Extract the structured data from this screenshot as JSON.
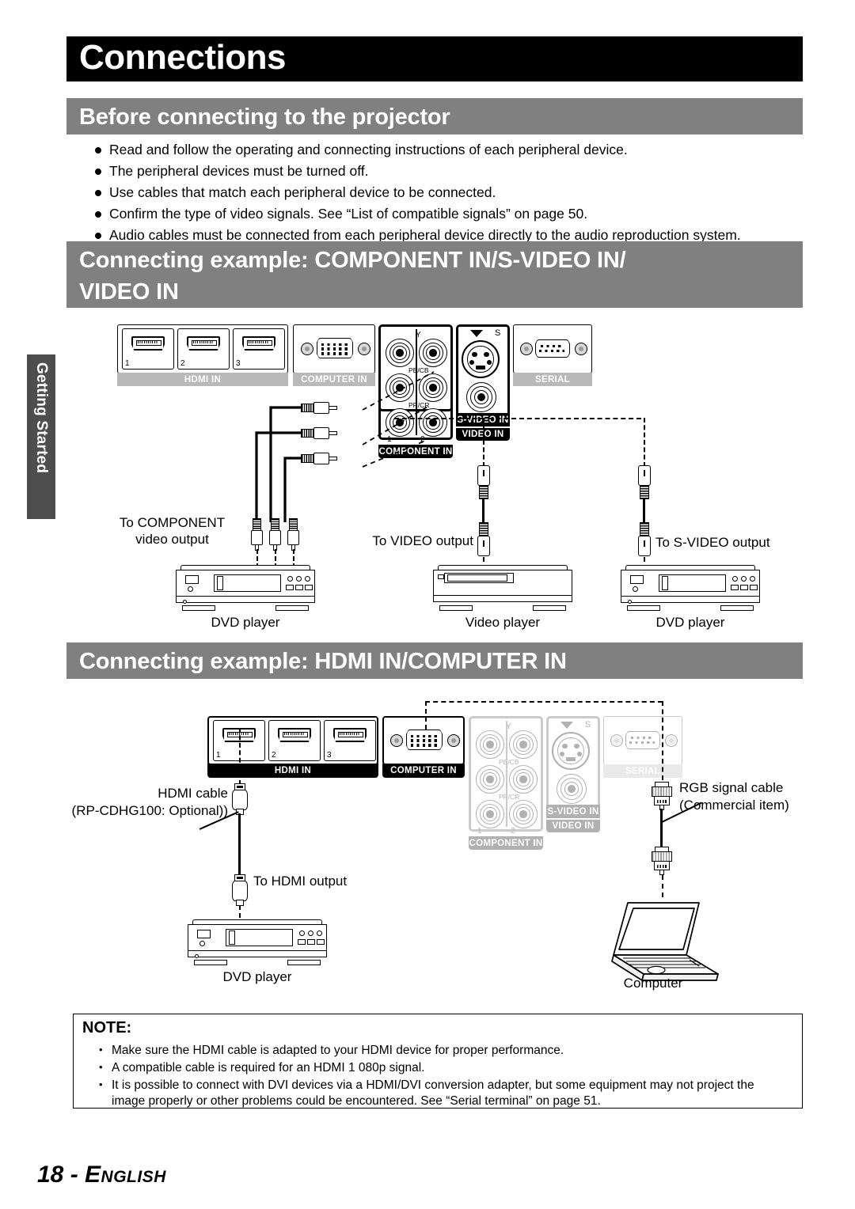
{
  "chapter": {
    "title": "Connections"
  },
  "side_tab": {
    "label": "Getting Started"
  },
  "sections": {
    "before": {
      "heading": "Before connecting to the projector",
      "bullets": [
        "Read and follow the operating and connecting instructions of each peripheral device.",
        "The peripheral devices must be turned off.",
        "Use cables that match each peripheral device to be connected.",
        "Confirm the type of video signals. See “List of compatible signals” on page 50.",
        "Audio cables must be connected from each peripheral device directly to the audio reproduction system."
      ]
    },
    "component_example": {
      "heading": "Connecting example: COMPONENT IN/S-VIDEO IN/\nVIDEO IN",
      "panel": {
        "hdmi_caption": "HDMI IN",
        "hdmi_numbers": [
          "1",
          "2",
          "3"
        ],
        "computer_caption": "COMPUTER IN",
        "component_caption": "COMPONENT IN",
        "component_numbers": [
          "1",
          "2"
        ],
        "component_rows": [
          "Y",
          "PB/CB",
          "PR/CR"
        ],
        "svideo_caption": "S-VIDEO IN",
        "video_caption": "VIDEO IN",
        "svideo_mark": "S",
        "serial_caption": "SERIAL"
      },
      "labels": {
        "component_out": "To COMPONENT\nvideo output",
        "video_out": "To VIDEO output",
        "svideo_out": "To S-VIDEO output"
      },
      "devices": [
        {
          "name": "DVD player"
        },
        {
          "name": "Video player"
        },
        {
          "name": "DVD player"
        }
      ]
    },
    "hdmi_example": {
      "heading": "Connecting example: HDMI IN/COMPUTER IN",
      "panel": {
        "hdmi_caption": "HDMI IN",
        "hdmi_numbers": [
          "1",
          "2",
          "3"
        ],
        "computer_caption": "COMPUTER IN",
        "component_caption": "COMPONENT IN",
        "component_numbers": [
          "1",
          "2"
        ],
        "component_rows": [
          "Y",
          "PB/CB",
          "PR/CR"
        ],
        "svideo_caption": "S-VIDEO IN",
        "video_caption": "VIDEO IN",
        "svideo_mark": "S",
        "serial_caption": "SERIAL"
      },
      "labels": {
        "hdmi_cable": "HDMI cable",
        "hdmi_cable_model": "(RP-CDHG100: Optional))",
        "hdmi_out": "To HDMI output",
        "rgb_cable": "RGB signal cable",
        "rgb_cable_note": "(Commercial item)",
        "dvd_player": "DVD player",
        "computer": "Computer"
      }
    }
  },
  "note": {
    "title": "NOTE:",
    "items": [
      "Make sure the HDMI cable is adapted to your HDMI device for proper performance.",
      "A compatible cable is required for an HDMI 1 080p signal.",
      "It is possible to connect with DVI devices via a HDMI/DVI conversion adapter, but some equipment may not project the image properly or other problems could be encountered. See “Serial terminal” on page 51."
    ]
  },
  "footer": {
    "page": "18 - ",
    "language": "English"
  },
  "colors": {
    "chapter_bar": "#000000",
    "section_bar": "#808080",
    "side_tab": "#4e4e4e",
    "caption_active": "#000000",
    "caption_inactive": "#b9b9b9"
  }
}
